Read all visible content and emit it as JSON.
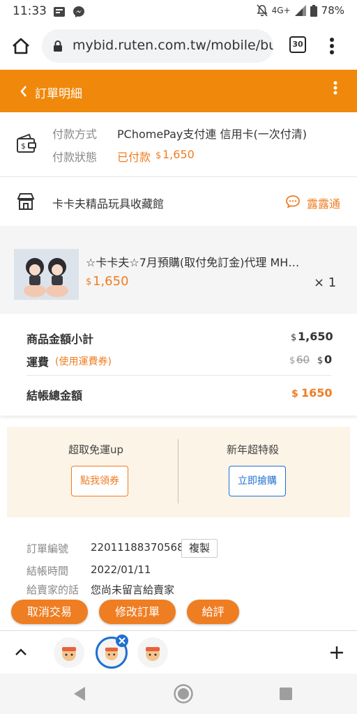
{
  "status_bar": {
    "time": "11:33",
    "network": "4G+",
    "battery": "78%"
  },
  "browser": {
    "url": "mybid.ruten.com.tw/mobile/buy",
    "tab_count": "30"
  },
  "header": {
    "title": "訂單明細"
  },
  "payment": {
    "method_label": "付款方式",
    "method_value": "PChomePay支付連 信用卡(一次付清)",
    "status_label": "付款狀態",
    "status_value": "已付款",
    "currency": "$",
    "amount": "1,650"
  },
  "shop": {
    "name": "卡卡夫精品玩具收藏館",
    "chat_label": "露露通"
  },
  "product": {
    "title": "☆卡卡夫☆7月預購(取付免訂金)代理 MH…",
    "currency": "$",
    "price": "1,650",
    "quantity": "× 1"
  },
  "summary": {
    "subtotal_label": "商品金額小計",
    "subtotal_currency": "$",
    "subtotal_value": "1,650",
    "shipping_label": "運費",
    "shipping_note": "(使用運費券)",
    "shipping_original_currency": "$",
    "shipping_original": "60",
    "shipping_currency": "$",
    "shipping_value": "0",
    "total_label": "結帳總金額",
    "total_currency": "$",
    "total_value": "1650"
  },
  "promo": {
    "left_title": "超取免運up",
    "left_button": "點我領券",
    "right_title": "新年超特殺",
    "right_button": "立即搶購"
  },
  "details": {
    "order_no_label": "訂單編號",
    "order_no_value": "22011188370568",
    "copy_label": "複製",
    "checkout_time_label": "結帳時間",
    "checkout_time_value": "2022/01/11",
    "message_label": "給賣家的話",
    "message_value": "您尚未留言給賣家"
  },
  "actions": {
    "cancel": "取消交易",
    "modify": "修改訂單",
    "review": "給評"
  },
  "colors": {
    "brand_orange": "#f0890b",
    "accent_orange": "#ef7d22",
    "link_blue": "#1f6fd1"
  }
}
